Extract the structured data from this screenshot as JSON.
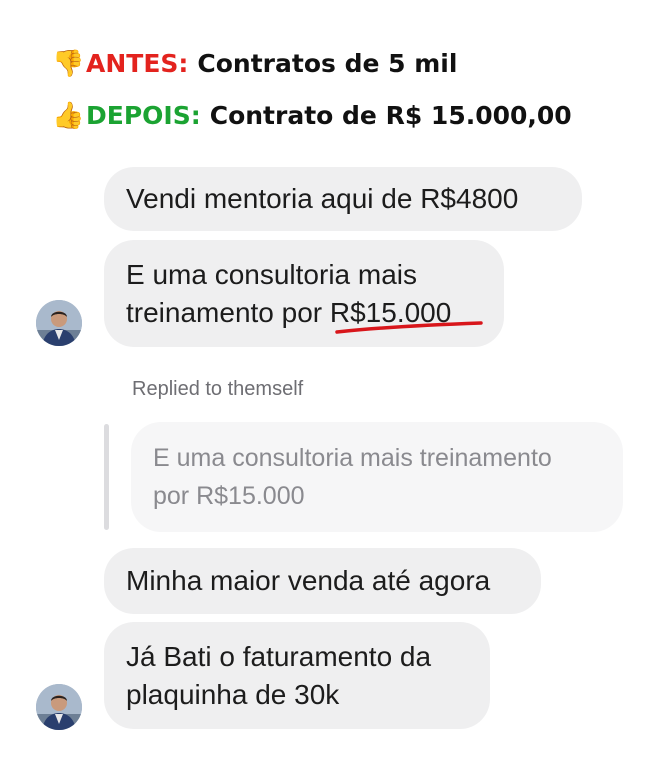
{
  "header": {
    "line1": {
      "emoji": "👎",
      "lead": "ANTES:",
      "rest": "Contratos de 5 mil"
    },
    "line2": {
      "emoji": "👍",
      "lead": "DEPOIS:",
      "rest": "Contrato de R$ 15.000,00"
    }
  },
  "colors": {
    "red": "#e3231e",
    "green": "#1ba332",
    "bubble": "#efeff0",
    "underline": "#d8161b"
  },
  "messages": [
    {
      "text": "Vendi mentoria aqui de R$4800"
    },
    {
      "text": "E uma consultoria mais\ntreinamento por R$15.000"
    },
    {
      "text": "Minha maior venda até agora"
    },
    {
      "text": "Já Bati o faturamento da\nplaquinha de 30k"
    }
  ],
  "reply": {
    "label": "Replied to themself",
    "quoted_text": "E uma consultoria mais treinamento\npor R$15.000"
  },
  "avatar": {
    "icon": "profile-photo"
  }
}
